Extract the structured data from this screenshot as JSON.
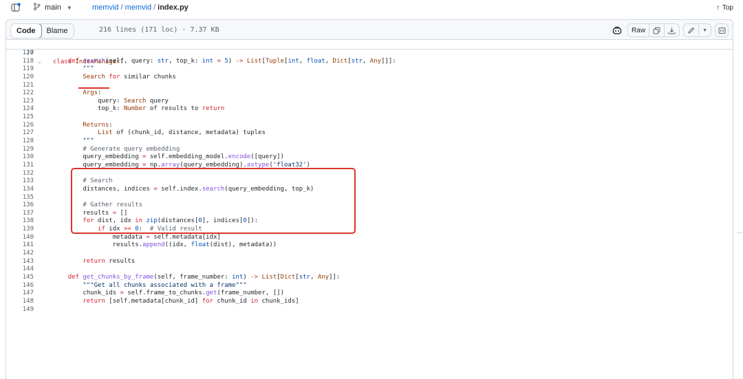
{
  "topbar": {
    "branch": "main",
    "repo_owner": "memvid",
    "repo_name": "memvid",
    "file": "index.py",
    "top_label": "Top"
  },
  "filebar": {
    "tab_code": "Code",
    "tab_blame": "Blame",
    "meta": "216 lines (171 loc) · 7.37 KB",
    "raw_label": "Raw"
  },
  "code": {
    "sticky_num": "20",
    "sticky_text": "class IndexManager:",
    "lines": [
      {
        "n": "117",
        "t": ""
      },
      {
        "n": "118",
        "t": "def search(self, query: str, top_k: int = 5) -> List[Tuple[int, float, Dict[str, Any]]]:"
      },
      {
        "n": "119",
        "t": "\"\"\""
      },
      {
        "n": "120",
        "t": "Search for similar chunks"
      },
      {
        "n": "121",
        "t": ""
      },
      {
        "n": "122",
        "t": "Args:"
      },
      {
        "n": "123",
        "t": "query: Search query"
      },
      {
        "n": "124",
        "t": "top_k: Number of results to return"
      },
      {
        "n": "125",
        "t": ""
      },
      {
        "n": "126",
        "t": "Returns:"
      },
      {
        "n": "127",
        "t": "List of (chunk_id, distance, metadata) tuples"
      },
      {
        "n": "128",
        "t": "\"\"\""
      },
      {
        "n": "129",
        "t": "# Generate query embedding"
      },
      {
        "n": "130",
        "t": "query_embedding = self.embedding_model.encode([query])"
      },
      {
        "n": "131",
        "t": "query_embedding = np.array(query_embedding).astype('float32')"
      },
      {
        "n": "132",
        "t": ""
      },
      {
        "n": "133",
        "t": "# Search"
      },
      {
        "n": "134",
        "t": "distances, indices = self.index.search(query_embedding, top_k)"
      },
      {
        "n": "135",
        "t": ""
      },
      {
        "n": "136",
        "t": "# Gather results"
      },
      {
        "n": "137",
        "t": "results = []"
      },
      {
        "n": "138",
        "t": "for dist, idx in zip(distances[0], indices[0]):"
      },
      {
        "n": "139",
        "t": "if idx >= 0:  # Valid result"
      },
      {
        "n": "140",
        "t": "metadata = self.metadata[idx]"
      },
      {
        "n": "141",
        "t": "results.append((idx, float(dist), metadata))"
      },
      {
        "n": "142",
        "t": ""
      },
      {
        "n": "143",
        "t": "return results"
      },
      {
        "n": "144",
        "t": ""
      },
      {
        "n": "145",
        "t": "def get_chunks_by_frame(self, frame_number: int) -> List[Dict[str, Any]]:"
      },
      {
        "n": "146",
        "t": "\"\"\"Get all chunks associated with a frame\"\"\""
      },
      {
        "n": "147",
        "t": "chunk_ids = self.frame_to_chunks.get(frame_number, [])"
      },
      {
        "n": "148",
        "t": "return [self.metadata[chunk_id] for chunk_id in chunk_ids]"
      },
      {
        "n": "149",
        "t": ""
      }
    ]
  },
  "colors": {
    "accent": "#0969da",
    "annotation": "#d9342b",
    "keyword": "#cf222e",
    "function": "#8250df",
    "string": "#0a3069",
    "comment": "#59636e"
  },
  "icons": [
    "side-panel-icon",
    "branch-icon",
    "arrow-up-icon",
    "copilot-icon",
    "copy-icon",
    "download-icon",
    "pencil-icon",
    "chevron-down-icon",
    "symbols-icon"
  ]
}
